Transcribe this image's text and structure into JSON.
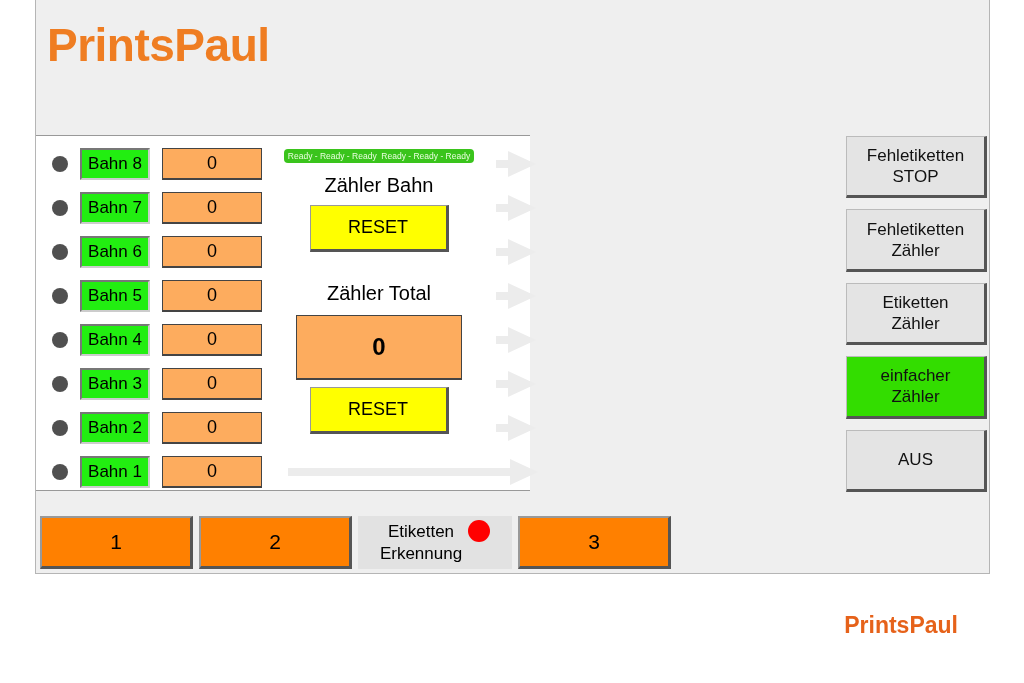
{
  "logo": "PrintsPaul",
  "lanes": [
    {
      "label": "Bahn 8",
      "count": "0",
      "active": true
    },
    {
      "label": "Bahn 7",
      "count": "0",
      "active": true
    },
    {
      "label": "Bahn 6",
      "count": "0",
      "active": true
    },
    {
      "label": "Bahn 5",
      "count": "0",
      "active": true
    },
    {
      "label": "Bahn 4",
      "count": "0",
      "active": true
    },
    {
      "label": "Bahn 3",
      "count": "0",
      "active": true
    },
    {
      "label": "Bahn 2",
      "count": "0",
      "active": true
    },
    {
      "label": "Bahn 1",
      "count": "0",
      "active": true
    }
  ],
  "status_text": "Ready - Ready - Ready  Ready - Ready - Ready",
  "lane_counter": {
    "title": "Zähler Bahn",
    "reset": "RESET"
  },
  "total_counter": {
    "title": "Zähler Total",
    "value": "0",
    "reset": "RESET"
  },
  "mode_buttons": [
    {
      "label": "Fehletiketten\nSTOP",
      "selected": false
    },
    {
      "label": "Fehletiketten\nZähler",
      "selected": false
    },
    {
      "label": "Etiketten\nZähler",
      "selected": false
    },
    {
      "label": "einfacher\nZähler",
      "selected": true
    },
    {
      "label": "AUS",
      "selected": false
    }
  ],
  "bottom_bar": [
    {
      "kind": "button",
      "label": "1"
    },
    {
      "kind": "button",
      "label": "2"
    },
    {
      "kind": "indicator",
      "label": "Etiketten\nErkennung",
      "color": "#ff0000"
    },
    {
      "kind": "button",
      "label": "3"
    }
  ],
  "footer_logo": "PrintsPaul"
}
